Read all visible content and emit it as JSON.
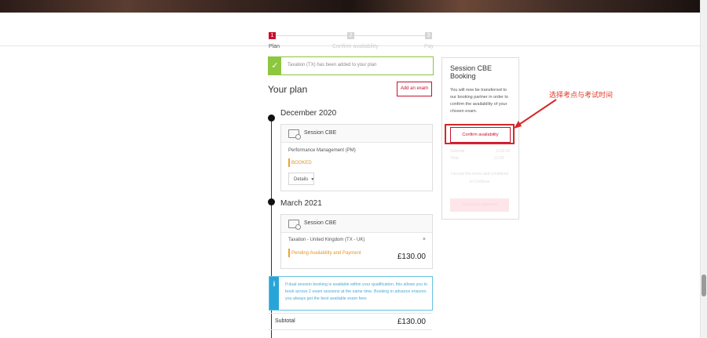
{
  "stepper": {
    "steps": [
      {
        "number": "1",
        "label": "Plan",
        "active": true
      },
      {
        "number": "2",
        "label": "Confirm availability",
        "active": false
      },
      {
        "number": "3",
        "label": "Pay",
        "active": false
      }
    ]
  },
  "alert": {
    "message": "Taxation (TX) has been added to your plan",
    "icon": "check-icon",
    "color": "#8dc63f"
  },
  "plan": {
    "title": "Your plan",
    "add_exam_label": "Add an exam",
    "accent_color": "#c8102e",
    "sections": [
      {
        "month": "December 2020",
        "card": {
          "header": "Session CBE",
          "exam": "Performance Management (PM)",
          "status": "BOOKED",
          "details_label": "Details"
        }
      },
      {
        "month": "March 2021",
        "card": {
          "header": "Session CBE",
          "exam": "Taxation - United Kingdom (TX - UK)",
          "close": "×",
          "status": "Pending Availability and Payment",
          "price": "£130.00"
        }
      }
    ],
    "info": {
      "icon": "i",
      "text": "If dual session booking is available within your qualification, this allows you to book across 2 exam sessions at the same time. Booking in advance ensures you always get the best available exam fees"
    },
    "subtotal": {
      "label": "Subtotal",
      "value": "£130.00"
    }
  },
  "side_panel": {
    "title": "Session CBE Booking",
    "description": "You will now be transferred to our booking partner in order to confirm the availability of your chosen exam.",
    "confirm_label": "Confirm availability",
    "faded_rows": [
      {
        "label": "Subtotal",
        "value": "£130.00"
      },
      {
        "label": "Total",
        "value": "£0.00"
      }
    ],
    "faded_text": "I accept the terms and conditions to Continue",
    "faded_button": "Proceed to payment"
  },
  "annotation": {
    "text": "选择考点与考试时间",
    "color": "#e03a2a"
  }
}
